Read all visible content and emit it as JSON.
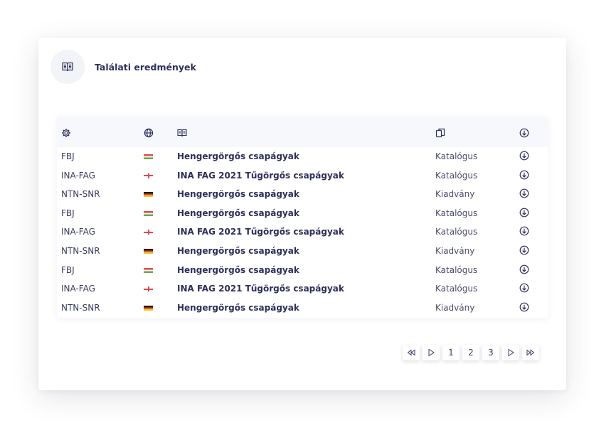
{
  "header": {
    "title": "Találati eredmények",
    "icon": "book-icon"
  },
  "table": {
    "columns": [
      {
        "key": "manufacturer",
        "icon": "gear-icon"
      },
      {
        "key": "language",
        "icon": "globe-icon"
      },
      {
        "key": "title",
        "icon": "book-icon"
      },
      {
        "key": "type",
        "icon": "documents-icon"
      },
      {
        "key": "download",
        "icon": "download-icon"
      }
    ],
    "rows": [
      {
        "manufacturer": "FBJ",
        "lang": "hu",
        "title": "Hengergörgős csapágyak",
        "type": "Katalógus"
      },
      {
        "manufacturer": "INA-FAG",
        "lang": "en",
        "title": "INA FAG 2021 Tűgörgős csapágyak",
        "type": "Katalógus"
      },
      {
        "manufacturer": "NTN-SNR",
        "lang": "de",
        "title": "Hengergörgős csapágyak",
        "type": "Kiadvány"
      },
      {
        "manufacturer": "FBJ",
        "lang": "hu",
        "title": "Hengergörgős csapágyak",
        "type": "Katalógus"
      },
      {
        "manufacturer": "INA-FAG",
        "lang": "en",
        "title": "INA FAG 2021 Tűgörgős csapágyak",
        "type": "Katalógus"
      },
      {
        "manufacturer": "NTN-SNR",
        "lang": "de",
        "title": "Hengergörgős csapágyak",
        "type": "Kiadvány"
      },
      {
        "manufacturer": "FBJ",
        "lang": "hu",
        "title": "Hengergörgős csapágyak",
        "type": "Katalógus"
      },
      {
        "manufacturer": "INA-FAG",
        "lang": "en",
        "title": "INA FAG 2021 Tűgörgős csapágyak",
        "type": "Katalógus"
      },
      {
        "manufacturer": "NTN-SNR",
        "lang": "de",
        "title": "Hengergörgős csapágyak",
        "type": "Kiadvány"
      }
    ]
  },
  "pagination": {
    "first": "first-page-icon",
    "prev": "prev-page-icon",
    "pages": [
      "1",
      "2",
      "3"
    ],
    "next": "next-page-icon",
    "last": "last-page-icon"
  },
  "colors": {
    "text": "#2b2d55",
    "hu": "#6aa84f",
    "en": "#e0474c",
    "de": "#d6402f"
  }
}
